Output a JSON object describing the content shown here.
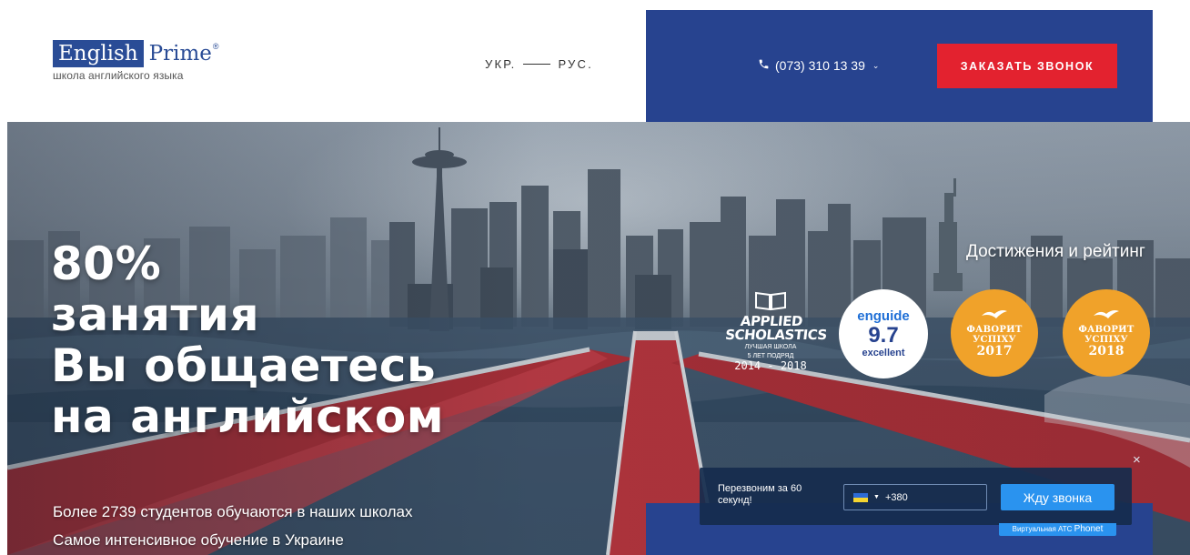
{
  "header": {
    "logo": {
      "word1": "English",
      "word2": "Prime",
      "reg": "®",
      "tagline": "школа английского языка"
    },
    "lang": {
      "ukr": "УКР.",
      "rus": "РУС."
    },
    "phone": {
      "icon": "phone-icon",
      "number": "(073) 310 13 39",
      "chevron": "⌄"
    },
    "cta": "ЗАКАЗАТЬ ЗВОНОК"
  },
  "hero": {
    "headline": [
      "80%",
      "занятия",
      "Вы общаетесь",
      "на английском"
    ],
    "sub1": "Более 2739 студентов обучаются в наших школах",
    "sub2": "Самое интенсивное обучение в Украине"
  },
  "achievements": {
    "title": "Достижения и рейтинг",
    "applied": {
      "name": "APPLIED SCHOLASTICS",
      "line1": "ЛУЧШАЯ ШКОЛА",
      "line2": "5 ЛЕТ ПОДРЯД",
      "years": "2014 - 2018"
    },
    "enguide": {
      "name": "enguide",
      "score": "9.7",
      "label": "excellent"
    },
    "fav1": {
      "line1": "ФАВОРИТ",
      "line2": "УСПІХУ",
      "year": "2017"
    },
    "fav2": {
      "line1": "ФАВОРИТ",
      "line2": "УСПІХУ",
      "year": "2018"
    }
  },
  "widget": {
    "text": "Перезвоним за 60 секунд!",
    "phone_prefix": "+380",
    "button": "Жду звонка",
    "brand_prefix": "Виртуальная АТС",
    "brand_name": "Phonet",
    "close": "×"
  },
  "colors": {
    "brand_blue": "#27438f",
    "cta_red": "#e3222f",
    "badge_gold": "#f0a22a",
    "widget_button": "#2a93ef"
  }
}
